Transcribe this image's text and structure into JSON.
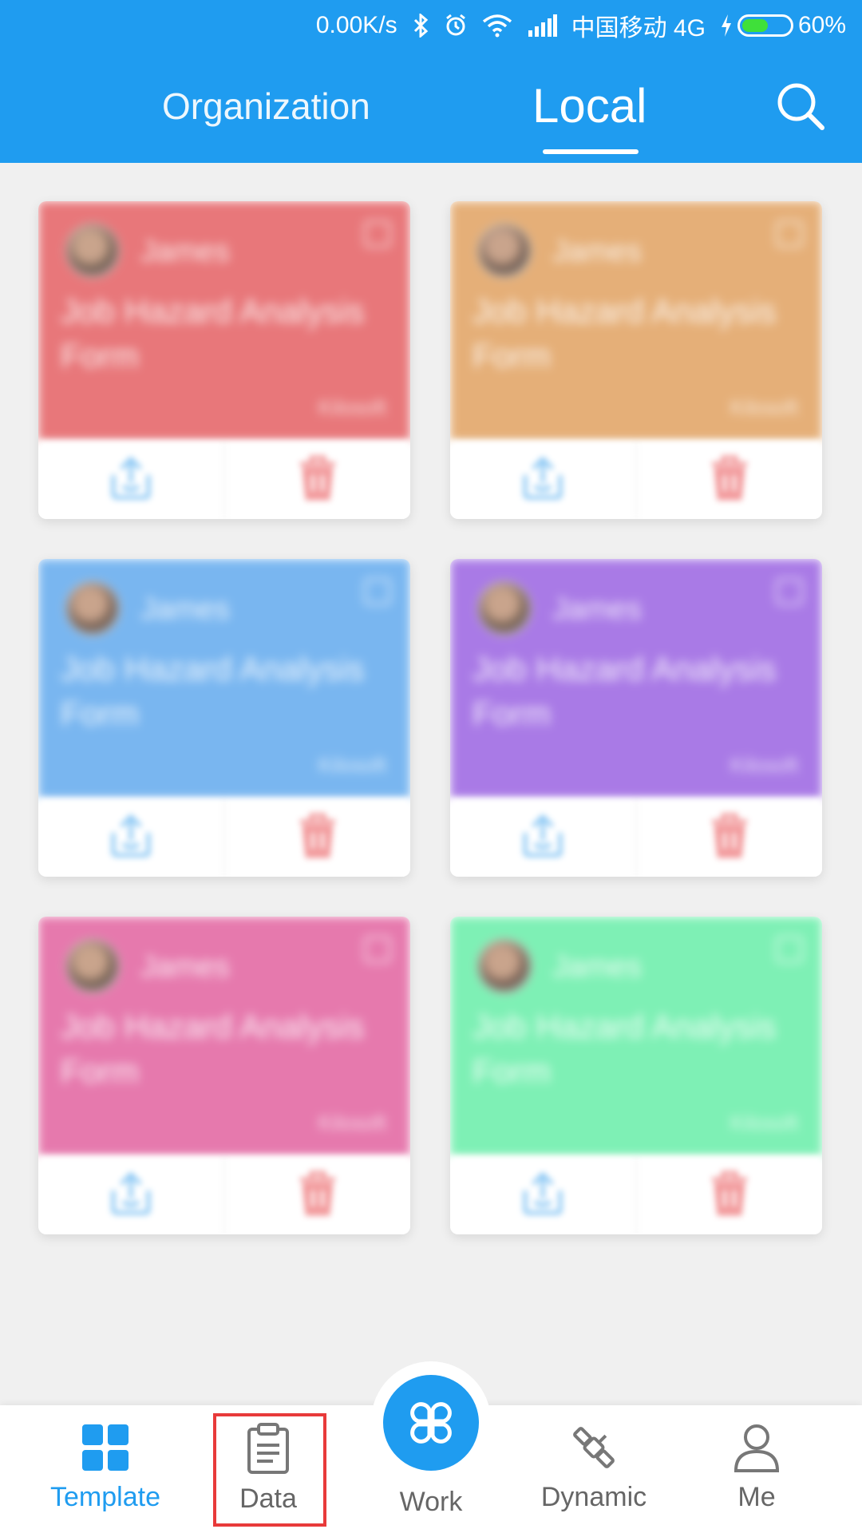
{
  "status_bar": {
    "speed": "0.00K/s",
    "carrier": "中国移动 4G",
    "battery": "60%",
    "battery_level": 0.6,
    "icons": [
      "bluetooth-icon",
      "alarm-icon",
      "wifi-icon",
      "signal-icon",
      "charging-icon",
      "battery-icon"
    ]
  },
  "header": {
    "tabs": [
      {
        "label": "Organization",
        "active": false
      },
      {
        "label": "Local",
        "active": true
      }
    ],
    "search_icon": "search-icon"
  },
  "cards": [
    {
      "user": "James",
      "title": "Job Hazard Analysis Form",
      "tag": "Kilosoft",
      "color": "#e8777a"
    },
    {
      "user": "James",
      "title": "Job Hazard Analysis Form",
      "tag": "Kilosoft",
      "color": "#e5af78"
    },
    {
      "user": "James",
      "title": "Job Hazard Analysis Form",
      "tag": "Kilosoft",
      "color": "#79b6f0"
    },
    {
      "user": "James",
      "title": "Job Hazard Analysis Form",
      "tag": "Kilosoft",
      "color": "#a97ae6"
    },
    {
      "user": "James",
      "title": "Job Hazard Analysis Form",
      "tag": "Kilosoft",
      "color": "#e679ad"
    },
    {
      "user": "James",
      "title": "Job Hazard Analysis Form",
      "tag": "Kilosoft",
      "color": "#7ef0b5"
    }
  ],
  "bottom_nav": {
    "items": [
      {
        "label": "Template",
        "icon": "grid-icon",
        "active": true
      },
      {
        "label": "Data",
        "icon": "clipboard-icon",
        "active": false
      },
      {
        "label": "Work",
        "icon": "clover-icon",
        "active": false
      },
      {
        "label": "Dynamic",
        "icon": "satellite-icon",
        "active": false
      },
      {
        "label": "Me",
        "icon": "person-icon",
        "active": false
      }
    ]
  },
  "colors": {
    "primary": "#1f9cf0",
    "highlight": "#e83a3a",
    "share_icon": "#8cc8f4",
    "delete_icon": "#f29a9c"
  }
}
